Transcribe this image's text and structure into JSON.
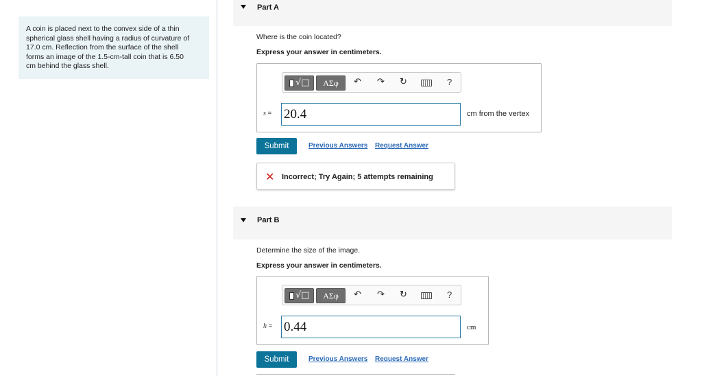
{
  "problem": {
    "line1": "A coin is placed next to the convex side of a thin",
    "line2": "spherical glass shell having a radius of curvature of",
    "line3": "17.0 cm. Reflection from the surface of the shell",
    "line4": "forms an image of the 1.5-cm-tall coin that is 6.50",
    "line5": "cm behind the glass shell."
  },
  "toolbar": {
    "templates_icon": "fraction-radical-template-icon",
    "greek_label": "ΑΣφ",
    "undo_icon": "undo-icon",
    "redo_icon": "redo-icon",
    "reset_icon": "reset-icon",
    "keyboard_icon": "keyboard-icon",
    "help_label": "?"
  },
  "partA": {
    "title": "Part A",
    "question": "Where is the coin located?",
    "instruction": "Express your answer in centimeters.",
    "variable": "s",
    "equals": "=",
    "value": "20.4",
    "units": "cm from the vertex",
    "submit": "Submit",
    "previous_answers": "Previous Answers",
    "request_answer": "Request Answer",
    "feedback": "Incorrect; Try Again; 5 attempts remaining",
    "feedback_icon": "x-icon"
  },
  "partB": {
    "title": "Part B",
    "question": "Determine the size of the image.",
    "instruction": "Express your answer in centimeters.",
    "variable": "h",
    "equals": "=",
    "value": "0.44",
    "units": "cm",
    "submit": "Submit",
    "previous_answers": "Previous Answers",
    "request_answer": "Request Answer"
  },
  "colors": {
    "accent": "#0c7399",
    "link": "#2a6ab8",
    "error": "#d11a1a",
    "problem_bg": "#eaf3f6"
  }
}
